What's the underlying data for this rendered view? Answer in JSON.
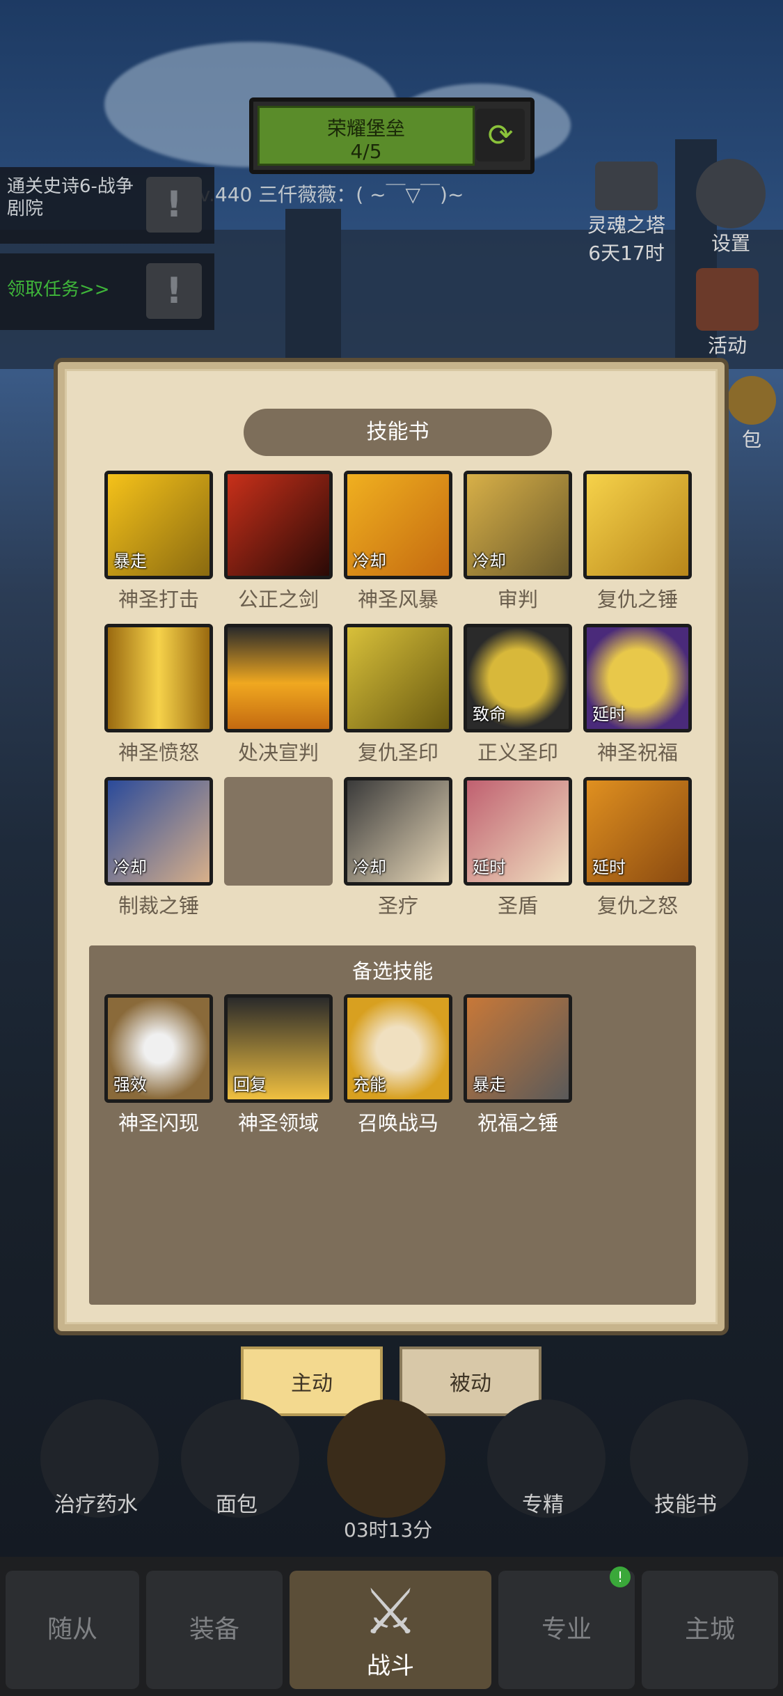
{
  "hud": {
    "banner_title": "荣耀堡垒",
    "banner_count": "4/5",
    "player_level": "Lv.440 三仟薇薇：( ~￣▽￣)~",
    "quest_1": "通关史诗6-战争剧院",
    "quest_2": "领取任务>>",
    "tower_label": "灵魂之塔",
    "tower_timer": "6天17时",
    "settings_label": "设置",
    "activity_label": "活动",
    "bag_label": "包"
  },
  "panel": {
    "title": "技能书",
    "skills": [
      {
        "name": "神圣打击",
        "tag": "暴走"
      },
      {
        "name": "公正之剑",
        "tag": ""
      },
      {
        "name": "神圣风暴",
        "tag": "冷却"
      },
      {
        "name": "审判",
        "tag": "冷却"
      },
      {
        "name": "复仇之锤",
        "tag": ""
      },
      {
        "name": "神圣愤怒",
        "tag": ""
      },
      {
        "name": "处决宣判",
        "tag": ""
      },
      {
        "name": "复仇圣印",
        "tag": ""
      },
      {
        "name": "正义圣印",
        "tag": "致命"
      },
      {
        "name": "神圣祝福",
        "tag": "延时"
      },
      {
        "name": "制裁之锤",
        "tag": "冷却"
      },
      {
        "name": "",
        "tag": ""
      },
      {
        "name": "圣疗",
        "tag": "冷却"
      },
      {
        "name": "圣盾",
        "tag": "延时"
      },
      {
        "name": "复仇之怒",
        "tag": "延时"
      }
    ],
    "reserve_title": "备选技能",
    "reserve_skills": [
      {
        "name": "神圣闪现",
        "tag": "强效"
      },
      {
        "name": "神圣领域",
        "tag": "回复"
      },
      {
        "name": "召唤战马",
        "tag": "充能"
      },
      {
        "name": "祝福之锤",
        "tag": "暴走"
      }
    ]
  },
  "tabs": {
    "active": "主动",
    "passive": "被动"
  },
  "bottom": {
    "potion": "治疗药水",
    "bread": "面包",
    "specialize": "专精",
    "skillbook": "技能书",
    "timer": "03时13分"
  },
  "nav": {
    "followers": "随从",
    "equipment": "装备",
    "battle": "战斗",
    "profession": "专业",
    "city": "主城"
  },
  "colors": {
    "panel_bg": "#e9dcbf",
    "panel_header": "#7d6e5a",
    "active_tab": "#f3d98f",
    "banner_green": "#5a8c2a"
  }
}
